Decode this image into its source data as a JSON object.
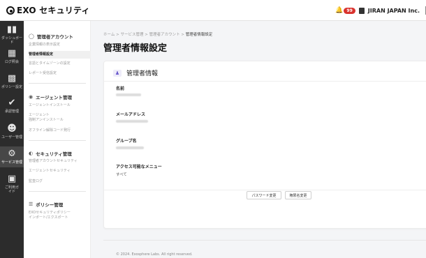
{
  "header": {
    "brand": "EXO セキュリティ",
    "notification_count": "99",
    "company": "JIRAN JAPAN Inc."
  },
  "rail": [
    {
      "icon": "chart-bar-icon",
      "label": "ダッシュボード"
    },
    {
      "icon": "log-icon",
      "label": "ログ照会"
    },
    {
      "icon": "policy-icon",
      "label": "ポリシー設定"
    },
    {
      "icon": "check-circle-icon",
      "label": "承認管理"
    },
    {
      "icon": "user-plus-icon",
      "label": "ユーザー管理"
    },
    {
      "icon": "gear-icon",
      "label": "サービス管理"
    },
    {
      "icon": "book-icon",
      "label": "ご利用ガイド"
    }
  ],
  "sidenav": {
    "admin_account": {
      "title": "管理者アカウント",
      "items": [
        "企業情報の表示設定",
        "管理者情報設定",
        "言語とタイムゾーンの設定",
        "レポート受信設定"
      ]
    },
    "agent": {
      "title": "エージェント管理",
      "items": [
        "エージェントインストール",
        "エージェント",
        "強制アンインストール",
        "オフライン解除コード発行"
      ]
    },
    "security": {
      "title": "セキュリティ管理",
      "items": [
        "管理者アカウントセキュリティ",
        "エージェントセキュリティ",
        "監査ログ"
      ]
    },
    "policy": {
      "title": "ポリシー管理",
      "items": [
        "EXOセキュリティポリシー",
        "インポート/エクスポート"
      ]
    }
  },
  "main": {
    "breadcrumb": [
      "ホーム",
      "サービス管理",
      "管理者アカウント",
      "管理者情報設定"
    ],
    "breadcrumb_sep": ">",
    "title": "管理者情報設定",
    "card": {
      "title": "管理者情報",
      "fields": [
        {
          "label": "名前"
        },
        {
          "label": "メールアドレス"
        },
        {
          "label": "グループ名"
        },
        {
          "label": "アクセス可能なメニュー",
          "value": "すべて"
        }
      ],
      "buttons": [
        "パスワード変更",
        "権限名変更"
      ]
    },
    "footer": "© 2024. Exosphere Labs. All right reserved."
  }
}
